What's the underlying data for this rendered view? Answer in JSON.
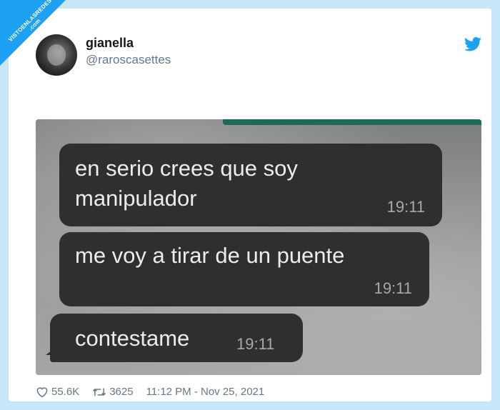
{
  "watermark": {
    "text": "VISTOENLASREDES .com"
  },
  "tweet": {
    "display_name": "gianella",
    "handle": "@raroscasettes",
    "likes": "55.6K",
    "retweets": "3625",
    "timestamp": "11:12 PM - Nov 25, 2021"
  },
  "messages": [
    {
      "text": "en serio crees que soy manipulador",
      "time": "19:11"
    },
    {
      "text": "me voy a tirar de un puente",
      "time": "19:11"
    },
    {
      "text": "contestame",
      "time": "19:11"
    }
  ],
  "colors": {
    "background": "#c7e6f7",
    "twitter_blue": "#1da1f2",
    "bubble": "#2e2f31",
    "chat_header": "#1d6a57"
  },
  "icons": {
    "platform": "twitter-bird-icon",
    "like": "heart-icon",
    "retweet": "retweet-icon"
  }
}
